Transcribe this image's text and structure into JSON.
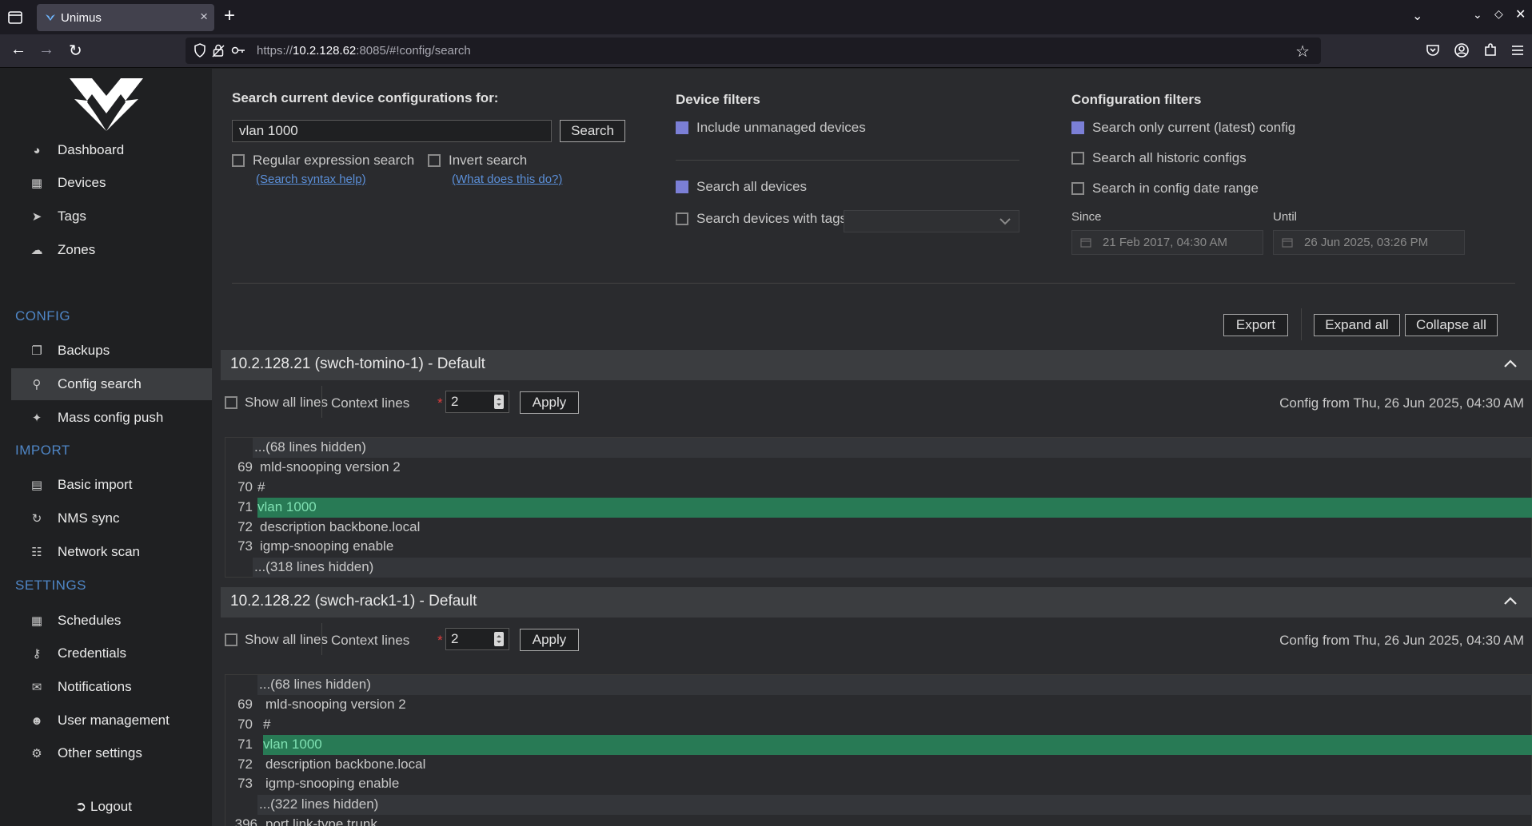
{
  "browser": {
    "tab_title": "Unimus",
    "url_prefix": "https://",
    "url_host": "10.2.128.62",
    "url_rest": ":8085/#!config/search",
    "new_tab": "+",
    "close_tab": "×"
  },
  "sidebar": {
    "items": [
      {
        "label": "Dashboard",
        "icon": "dashboard-icon"
      },
      {
        "label": "Devices",
        "icon": "devices-icon"
      },
      {
        "label": "Tags",
        "icon": "tags-icon"
      },
      {
        "label": "Zones",
        "icon": "cloud-icon"
      }
    ],
    "config_label": "CONFIG",
    "config_items": [
      {
        "label": "Backups",
        "icon": "backups-icon"
      },
      {
        "label": "Config search",
        "icon": "search-icon"
      },
      {
        "label": "Mass config push",
        "icon": "puzzle-icon"
      }
    ],
    "import_label": "IMPORT",
    "import_items": [
      {
        "label": "Basic import",
        "icon": "file-icon"
      },
      {
        "label": "NMS sync",
        "icon": "sync-icon"
      },
      {
        "label": "Network scan",
        "icon": "network-icon"
      }
    ],
    "settings_label": "SETTINGS",
    "settings_items": [
      {
        "label": "Schedules",
        "icon": "calendar-icon"
      },
      {
        "label": "Credentials",
        "icon": "key-icon"
      },
      {
        "label": "Notifications",
        "icon": "envelope-icon"
      },
      {
        "label": "User management",
        "icon": "users-icon"
      },
      {
        "label": "Other settings",
        "icon": "gears-icon"
      }
    ],
    "logout": "Logout"
  },
  "search": {
    "heading": "Search current device configurations for:",
    "query": "vlan 1000",
    "search_button": "Search",
    "regex_label": "Regular expression search",
    "regex_help": "(Search syntax help)",
    "invert_label": "Invert search",
    "invert_help": "(What does this do?)"
  },
  "device_filters": {
    "heading": "Device filters",
    "include_unmanaged": "Include unmanaged devices",
    "search_all": "Search all devices",
    "search_tags": "Search devices with tags"
  },
  "config_filters": {
    "heading": "Configuration filters",
    "only_current": "Search only current (latest) config",
    "all_historic": "Search all historic configs",
    "date_range": "Search in config date range",
    "since_label": "Since",
    "since_value": "21 Feb 2017, 04:30 AM",
    "until_label": "Until",
    "until_value": "26 Jun 2025, 03:26 PM"
  },
  "actions": {
    "export": "Export",
    "expand_all": "Expand all",
    "collapse_all": "Collapse all"
  },
  "results": [
    {
      "title": "10.2.128.21 (swch-tomino-1) - Default",
      "show_all_lines": "Show all lines",
      "context_lines_label": "Context lines",
      "asterisk": "*",
      "context_lines_value": "2",
      "apply": "Apply",
      "config_from": "Config from Thu, 26 Jun 2025, 04:30 AM",
      "lines": [
        {
          "num": "",
          "text": "...(68 lines hidden)",
          "kind": "hidden"
        },
        {
          "num": "69",
          "text": "mld-snooping version 2",
          "kind": "normal"
        },
        {
          "num": "70",
          "text": "#",
          "kind": "normal"
        },
        {
          "num": "71",
          "text": "vlan 1000",
          "kind": "match"
        },
        {
          "num": "72",
          "text": "description backbone.local",
          "kind": "normal"
        },
        {
          "num": "73",
          "text": "igmp-snooping enable",
          "kind": "normal"
        },
        {
          "num": "",
          "text": "...(318 lines hidden)",
          "kind": "hidden"
        }
      ]
    },
    {
      "title": "10.2.128.22 (swch-rack1-1) - Default",
      "show_all_lines": "Show all lines",
      "context_lines_label": "Context lines",
      "asterisk": "*",
      "context_lines_value": "2",
      "apply": "Apply",
      "config_from": "Config from Thu, 26 Jun 2025, 04:30 AM",
      "lines": [
        {
          "num": "",
          "text": "...(68 lines hidden)",
          "kind": "hidden"
        },
        {
          "num": "69",
          "text": "mld-snooping version 2",
          "kind": "normal"
        },
        {
          "num": "70",
          "text": "#",
          "kind": "normal"
        },
        {
          "num": "71",
          "text": "vlan 1000",
          "kind": "match"
        },
        {
          "num": "72",
          "text": "description backbone.local",
          "kind": "normal"
        },
        {
          "num": "73",
          "text": "igmp-snooping enable",
          "kind": "normal"
        },
        {
          "num": "",
          "text": "...(322 lines hidden)",
          "kind": "hidden"
        },
        {
          "num": "396",
          "text": "port link-type trunk",
          "kind": "normal"
        }
      ]
    }
  ]
}
